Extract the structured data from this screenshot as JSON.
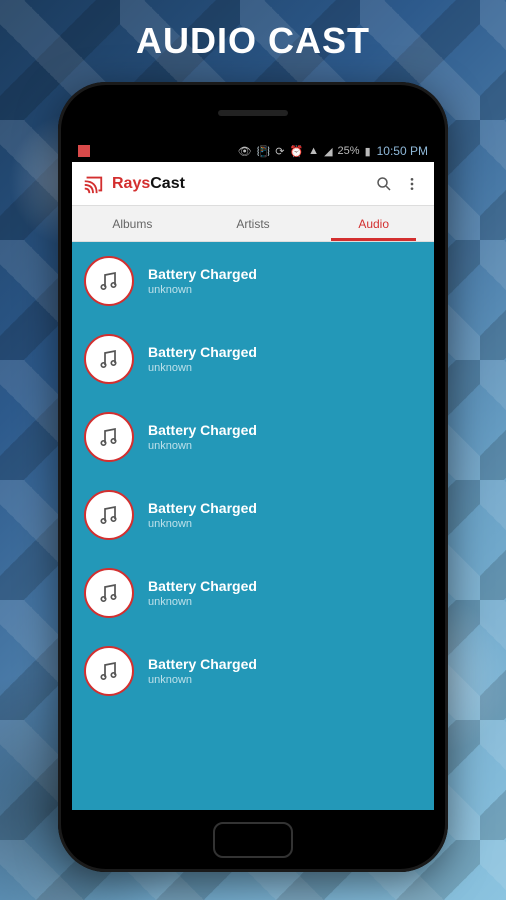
{
  "page_title": "AUDIO CAST",
  "status": {
    "battery_text": "25%",
    "time": "10:50 PM"
  },
  "appbar": {
    "name_red": "Rays",
    "name_black": "Cast"
  },
  "tabs": [
    {
      "label": "Albums",
      "active": false
    },
    {
      "label": "Artists",
      "active": false
    },
    {
      "label": "Audio",
      "active": true
    }
  ],
  "items": [
    {
      "title": "Battery Charged",
      "subtitle": "unknown"
    },
    {
      "title": "Battery Charged",
      "subtitle": "unknown"
    },
    {
      "title": "Battery Charged",
      "subtitle": "unknown"
    },
    {
      "title": "Battery Charged",
      "subtitle": "unknown"
    },
    {
      "title": "Battery Charged",
      "subtitle": "unknown"
    },
    {
      "title": "Battery Charged",
      "subtitle": "unknown"
    }
  ]
}
